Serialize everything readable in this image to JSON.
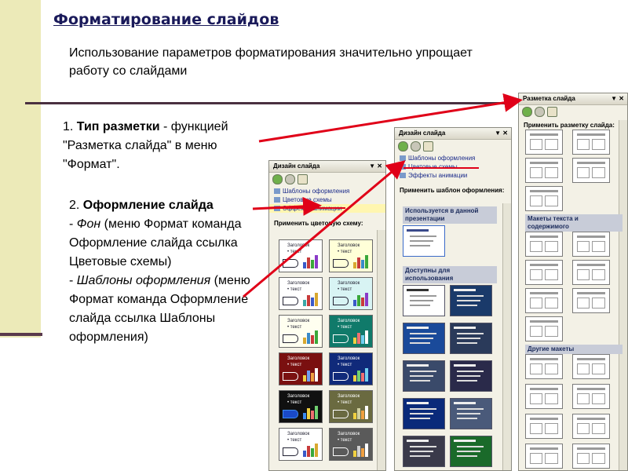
{
  "slide": {
    "title": "Форматирование слайдов",
    "intro": "Использование параметров форматирования значительно упрощает работу со слайдами",
    "point1": {
      "num": "1. ",
      "term": "Тип разметки",
      "desc": " - функцией \"Разметка слайда\" в меню \"Формат\"."
    },
    "point2": {
      "num": "2. ",
      "term": "Оформление слайда",
      "line_a_prefix": "- ",
      "line_a_term": "Фон",
      "line_a_desc": " (меню Формат команда Оформление слайда ссылка Цветовые схемы)",
      "line_b_prefix": "- ",
      "line_b_term": "Шаблоны оформления",
      "line_b_desc": " (меню Формат команда Оформление слайда ссылка Шаблоны оформления)"
    }
  },
  "pane_color": {
    "title": "Дизайн слайда",
    "controls": "▼ ✕",
    "links": [
      "Шаблоны оформления",
      "Цветовые схемы",
      "Эффекты анимации"
    ],
    "section_label": "Применить цветовую схему:",
    "thumb_title": "Заголовок",
    "thumb_text": "• текст"
  },
  "pane_templates": {
    "title": "Дизайн слайда",
    "controls": "▼ ✕",
    "links": [
      "Шаблоны оформления",
      "Цветовые схемы",
      "Эффекты анимации"
    ],
    "section_label": "Применить шаблон оформления:",
    "group_used": "Используется в данной презентации",
    "group_available": "Доступны для использования"
  },
  "pane_layout": {
    "title": "Разметка слайда",
    "controls": "▼ ✕",
    "section_label": "Применить разметку слайда:",
    "group_text_content": "Макеты текста и содержимого",
    "group_other": "Другие макеты"
  },
  "colors": {
    "arrow": "#E00018",
    "title_text": "#1A1A5A",
    "sidebar": "#ECEAB8"
  }
}
